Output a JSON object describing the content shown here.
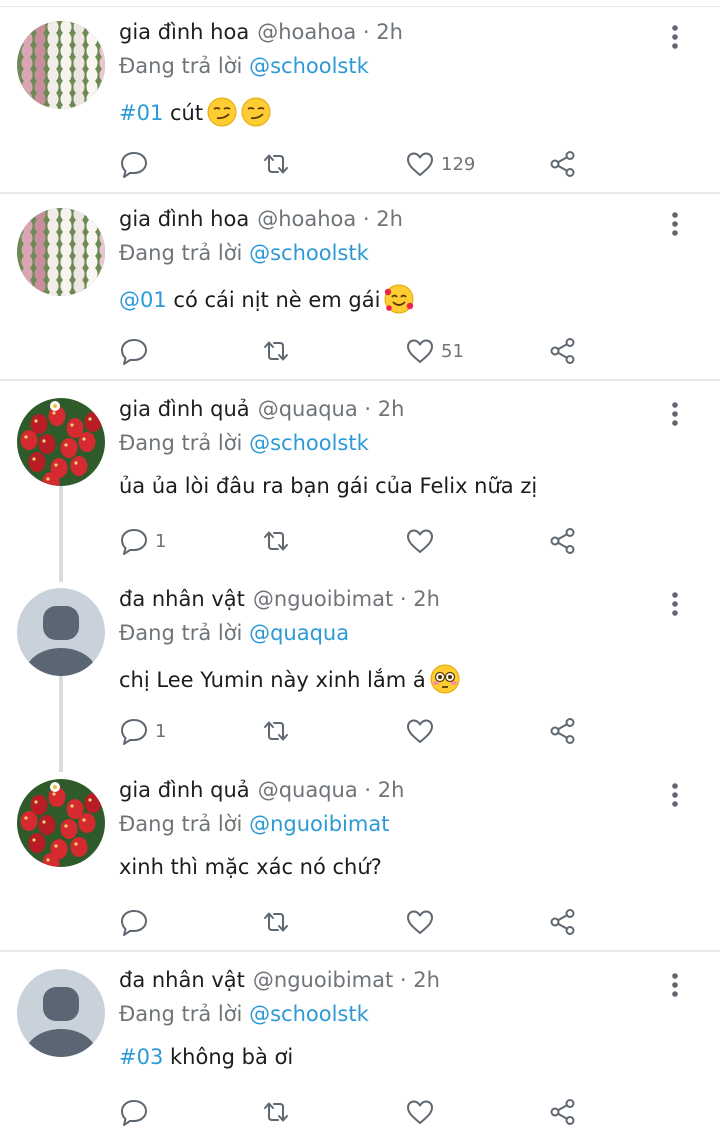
{
  "tweets": [
    {
      "name": "gia đình hoa",
      "handle": "@hoahoa · 2h",
      "reply_prefix": "Đang trả lời",
      "reply_to": "@schoolstk",
      "tag": "#01",
      "text": " cút",
      "emoji": "smirk-emoji smirk-emoji",
      "replies": "",
      "likes": "129",
      "avatar": "tulips"
    },
    {
      "name": "gia đình hoa",
      "handle": "@hoahoa · 2h",
      "reply_prefix": "Đang trả lời",
      "reply_to": "@schoolstk",
      "tag": "@01",
      "text": " có cái nịt nè em gái",
      "emoji": "smiling-face-with-hearts-emoji",
      "replies": "",
      "likes": "51",
      "avatar": "tulips"
    },
    {
      "name": "gia đình quả",
      "handle": "@quaqua · 2h",
      "reply_prefix": "Đang trả lời",
      "reply_to": "@schoolstk",
      "tag": "",
      "text": "ủa ủa lòi đâu ra bạn gái của Felix nữa zị",
      "emoji": "",
      "replies": "1",
      "likes": "",
      "avatar": "strawberries"
    },
    {
      "name": "đa nhân vật",
      "handle": "@nguoibimat · 2h",
      "reply_prefix": "Đang trả lời",
      "reply_to": "@quaqua",
      "tag": "",
      "text": "chị Lee Yumin này xinh lắm á",
      "emoji": "flushed-face-emoji",
      "replies": "1",
      "likes": "",
      "avatar": "default-person"
    },
    {
      "name": "gia đình quả",
      "handle": "@quaqua · 2h",
      "reply_prefix": "Đang trả lời",
      "reply_to": "@nguoibimat",
      "tag": "",
      "text": "xinh thì mặc xác nó chứ?",
      "emoji": "",
      "replies": "",
      "likes": "",
      "avatar": "strawberries"
    },
    {
      "name": "đa nhân vật",
      "handle": "@nguoibimat · 2h",
      "reply_prefix": "Đang trả lời",
      "reply_to": "@schoolstk",
      "tag": "#03",
      "text": " không bà ơi",
      "emoji": "",
      "replies": "",
      "likes": "",
      "avatar": "default-person"
    }
  ],
  "colors": {
    "link": "#2c9ad6",
    "secondary_text": "#6f7479",
    "icon": "#5f6770",
    "divider": "#e8e8e8",
    "thread_line": "#d7dce0"
  }
}
